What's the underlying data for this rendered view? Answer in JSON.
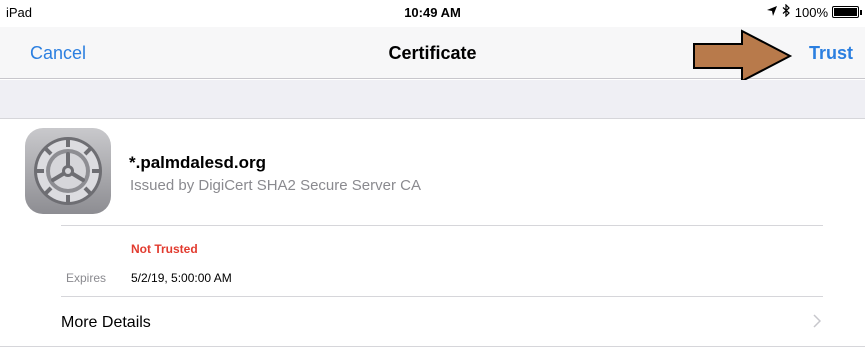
{
  "status_bar": {
    "device": "iPad",
    "time": "10:49 AM",
    "battery_percent": "100%",
    "battery_level": 1.0
  },
  "nav": {
    "cancel_label": "Cancel",
    "title": "Certificate",
    "trust_label": "Trust"
  },
  "certificate": {
    "name": "*.palmdalesd.org",
    "issuer": "Issued by DigiCert SHA2 Secure Server CA",
    "trust_status": "Not Trusted",
    "expires_label": "Expires",
    "expires_value": "5/2/19, 5:00:00 AM"
  },
  "more_details": {
    "label": "More Details"
  },
  "colors": {
    "accent": "#2b7fe0",
    "not_trusted": "#e23b2f",
    "arrow_fill": "#b87a4b"
  }
}
